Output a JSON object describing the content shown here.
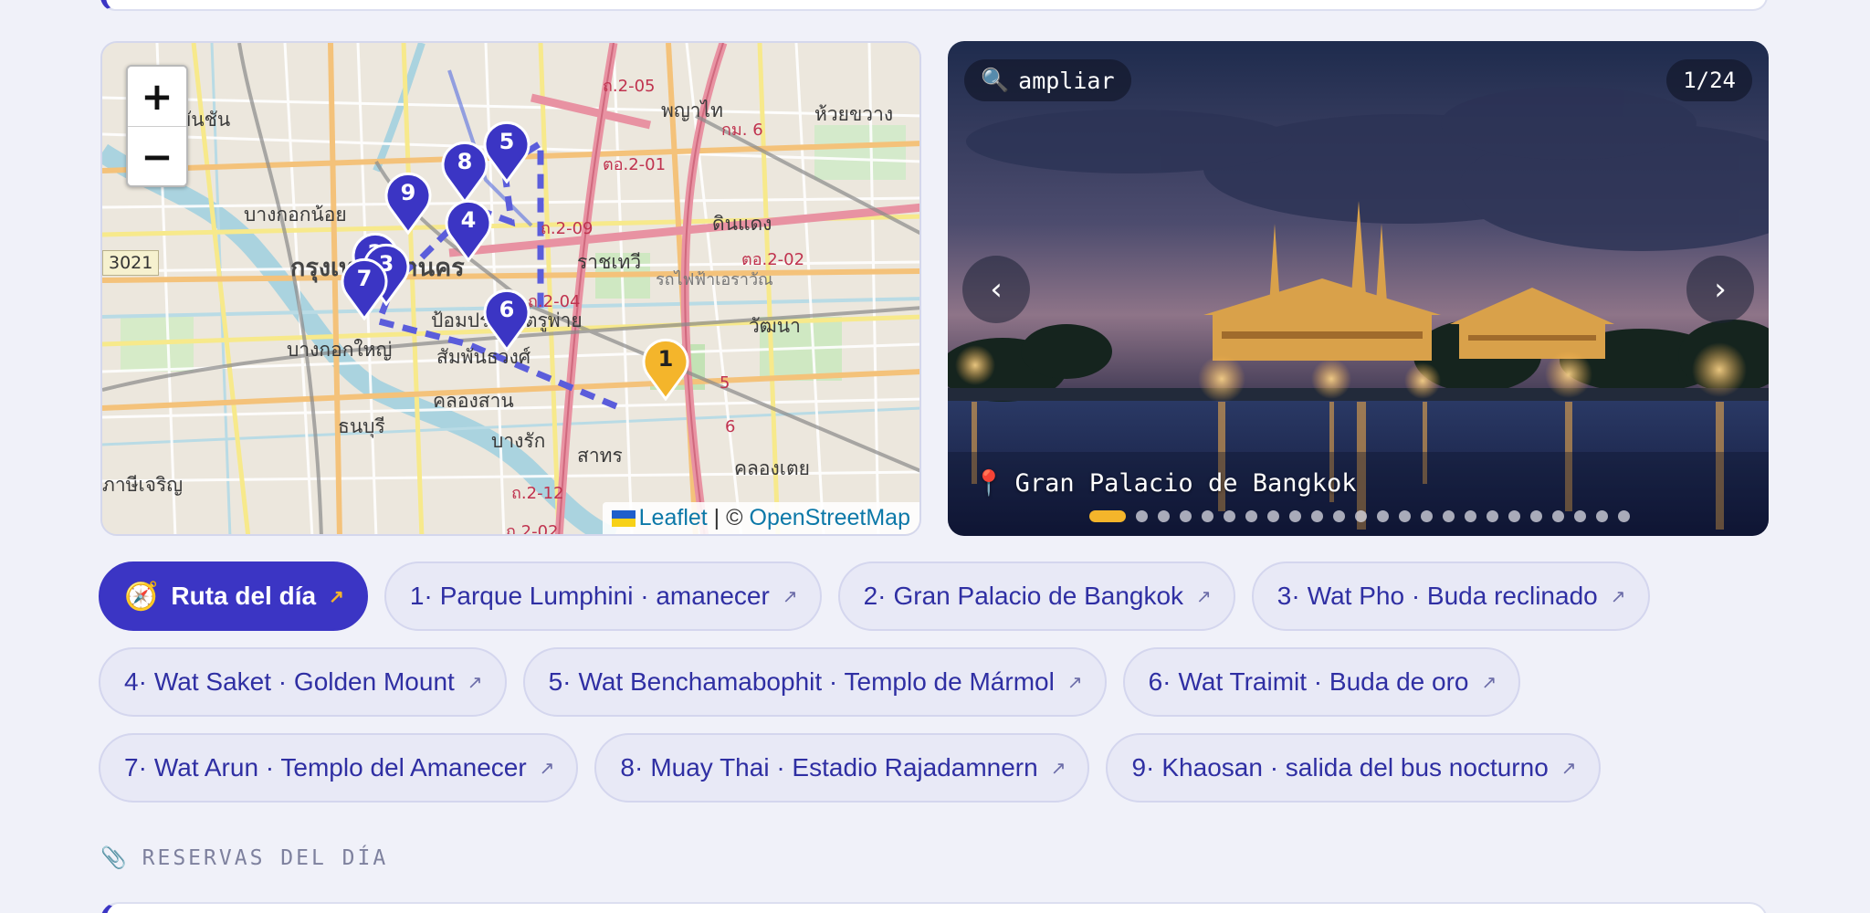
{
  "map": {
    "zoom_in": "+",
    "zoom_out": "−",
    "labels": {
      "phaya_thai": "พญาไท",
      "huai_khwang": "ห้วยขวาง",
      "bangkok_noi": "บางกอกน้อย",
      "din_daeng": "ดินแดง",
      "ratchathewi": "ราชเทวี",
      "krung_thep": "กรุงเทพมหานคร",
      "pom_prap": "ป้อมปราบศัตรูพ่าย",
      "wattana": "วัฒนา",
      "bangkok_yai": "บางกอกใหญ่",
      "samphanthawong": "สัมพันธวงศ์",
      "khlong_san": "คลองสาน",
      "thon_buri": "ธนบุรี",
      "bang_rak": "บางรัก",
      "sathon": "สาทร",
      "khlong_toei": "คลองเตย",
      "phasi_charoen": "ภาษีเจริญ",
      "yan_chan": "ยันชัน",
      "rail": "รถไฟฟ้าเอราวัณ",
      "rd_205": "ถ.2-05",
      "rd_6": "กม. 6",
      "rd_201": "ตอ.2-01",
      "rd_209": "ถ.2-09",
      "rd_202": "ตอ.2-02",
      "rd_204": "ถ.2-04",
      "rd_212": "ถ.2-12",
      "rd_202b": "ถ.2-02",
      "rd_5": "5",
      "rd_6b": "6",
      "badge": "3021"
    },
    "markers": [
      "1",
      "2",
      "3",
      "4",
      "5",
      "6",
      "7",
      "8",
      "9"
    ],
    "attribution": {
      "leaflet": "Leaflet",
      "sep": "|",
      "copy": "©",
      "osm": "OpenStreetMap"
    }
  },
  "gallery": {
    "zoom_label": "ampliar",
    "zoom_icon": "🔍",
    "counter": "1/24",
    "prev": "‹",
    "next": "›",
    "caption_icon": "📍",
    "caption": "Gran Palacio de Bangkok",
    "total_images": 24,
    "current_index": 1
  },
  "route": {
    "primary_icon": "🧭",
    "primary_label": "Ruta del día",
    "arrow": "↗",
    "stops": [
      {
        "num": "1·",
        "label": "Parque Lumphini · amanecer"
      },
      {
        "num": "2·",
        "label": "Gran Palacio de Bangkok"
      },
      {
        "num": "3·",
        "label": "Wat Pho · Buda reclinado"
      },
      {
        "num": "4·",
        "label": "Wat Saket · Golden Mount"
      },
      {
        "num": "5·",
        "label": "Wat Benchamabophit · Templo de Mármol"
      },
      {
        "num": "6·",
        "label": "Wat Traimit · Buda de oro"
      },
      {
        "num": "7·",
        "label": "Wat Arun · Templo del Amanecer"
      },
      {
        "num": "8·",
        "label": "Muay Thai · Estadio Rajadamnern"
      },
      {
        "num": "9·",
        "label": "Khaosan · salida del bus nocturno"
      }
    ]
  },
  "section": {
    "icon": "📎",
    "title": "RESERVAS DEL DÍA"
  },
  "colors": {
    "accent": "#3b35c4",
    "gold": "#f4b52b",
    "background": "#f0f1f9"
  }
}
